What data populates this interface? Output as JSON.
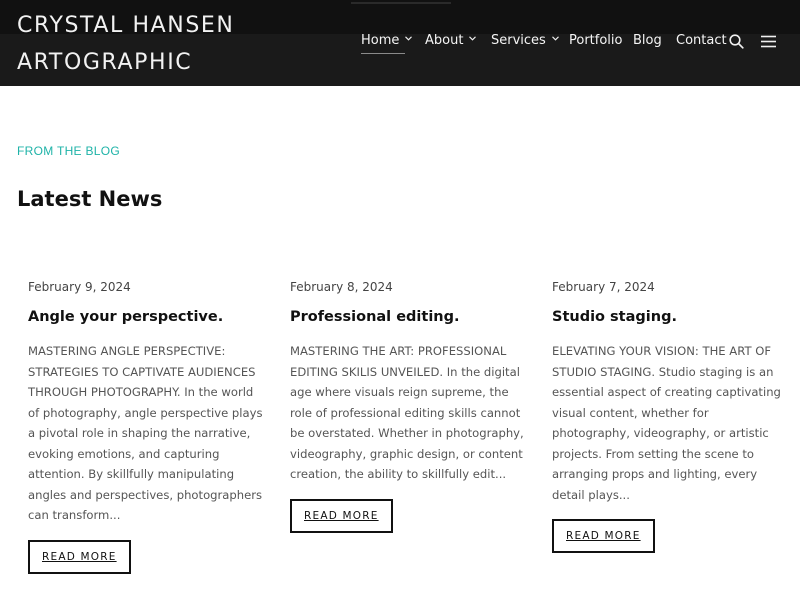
{
  "site": {
    "logo_line1": "CRYSTAL HANSEN",
    "logo_line2": "ARTOGRAPHIC"
  },
  "nav": {
    "items": [
      {
        "label": "Home",
        "has_dropdown": true,
        "active": true
      },
      {
        "label": "About",
        "has_dropdown": true
      },
      {
        "label": "Services",
        "has_dropdown": true
      },
      {
        "label": "Portfolio",
        "has_dropdown": false
      },
      {
        "label": "Blog",
        "has_dropdown": false
      },
      {
        "label": "Contact",
        "has_dropdown": false
      }
    ],
    "search_icon": "search-icon",
    "menu_icon": "sidebar-toggle-icon"
  },
  "section": {
    "eyebrow": "FROM THE BLOG",
    "title": "Latest News"
  },
  "posts": [
    {
      "date": "February 9, 2024",
      "title": "Angle your perspective.",
      "excerpt": "MASTERING ANGLE PERSPECTIVE: STRATEGIES TO CAPTIVATE AUDIENCES THROUGH PHOTOGRAPHY. In the world of photography, angle perspective plays a pivotal role in shaping the narrative, evoking emotions, and capturing attention. By skillfully manipulating angles and perspectives, photographers can transform...",
      "button": "READ MORE"
    },
    {
      "date": "February 8, 2024",
      "title": "Professional editing.",
      "excerpt": "MASTERING THE ART: PROFESSIONAL EDITING SKILIS UNVEILED. In the digital age where visuals reign supreme, the role of professional editing skills cannot be overstated. Whether in photography, videography, graphic design, or content creation, the ability to skillfully edit...",
      "button": "READ MORE"
    },
    {
      "date": "February 7, 2024",
      "title": "Studio staging.",
      "excerpt": "ELEVATING YOUR VISION: THE ART OF STUDIO STAGING. Studio staging is an essential aspect of creating captivating visual content, whether for photography, videography, or artistic projects. From setting the scene to arranging props and lighting, every detail plays...",
      "button": "READ MORE"
    }
  ],
  "colors": {
    "header_bg": "#1a1a1a",
    "accent": "#1fb3a8",
    "text": "#111111",
    "muted": "#555555"
  }
}
